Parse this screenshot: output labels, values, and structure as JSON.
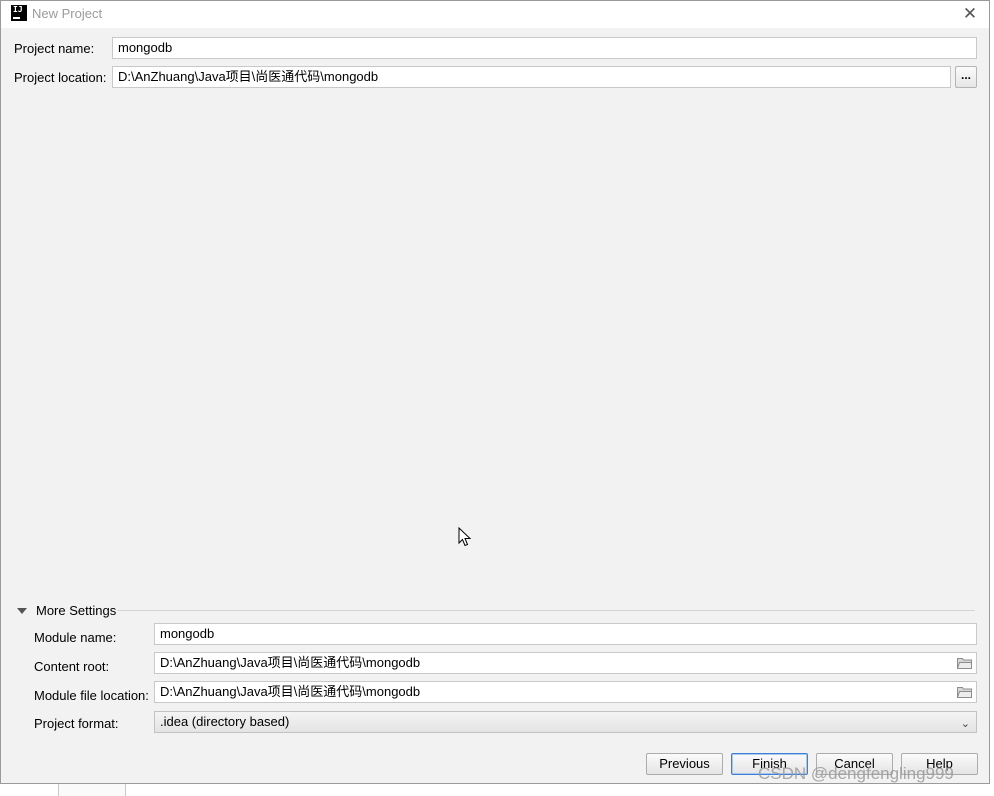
{
  "window": {
    "title": "New Project",
    "close_glyph": "✕",
    "app_icon_label": "IJ"
  },
  "form": {
    "project_name": {
      "label": "Project name:",
      "value": "mongodb"
    },
    "project_location": {
      "label": "Project location:",
      "value": "D:\\AnZhuang\\Java项目\\尚医通代码\\mongodb",
      "browse_label": "..."
    }
  },
  "more_settings": {
    "title": "More Settings",
    "module_name": {
      "label": "Module name:",
      "value": "mongodb"
    },
    "content_root": {
      "label": "Content root:",
      "value": "D:\\AnZhuang\\Java项目\\尚医通代码\\mongodb"
    },
    "module_file_location": {
      "label": "Module file location:",
      "value": "D:\\AnZhuang\\Java项目\\尚医通代码\\mongodb"
    },
    "project_format": {
      "label": "Project format:",
      "value": ".idea (directory based)"
    }
  },
  "buttons": {
    "previous": "Previous",
    "finish": "Finish",
    "cancel": "Cancel",
    "help": "Help"
  },
  "watermark": "CSDN @dengfengling999",
  "colors": {
    "dialog_bg": "#f2f2f2",
    "focus_border": "#3d7fd6"
  }
}
